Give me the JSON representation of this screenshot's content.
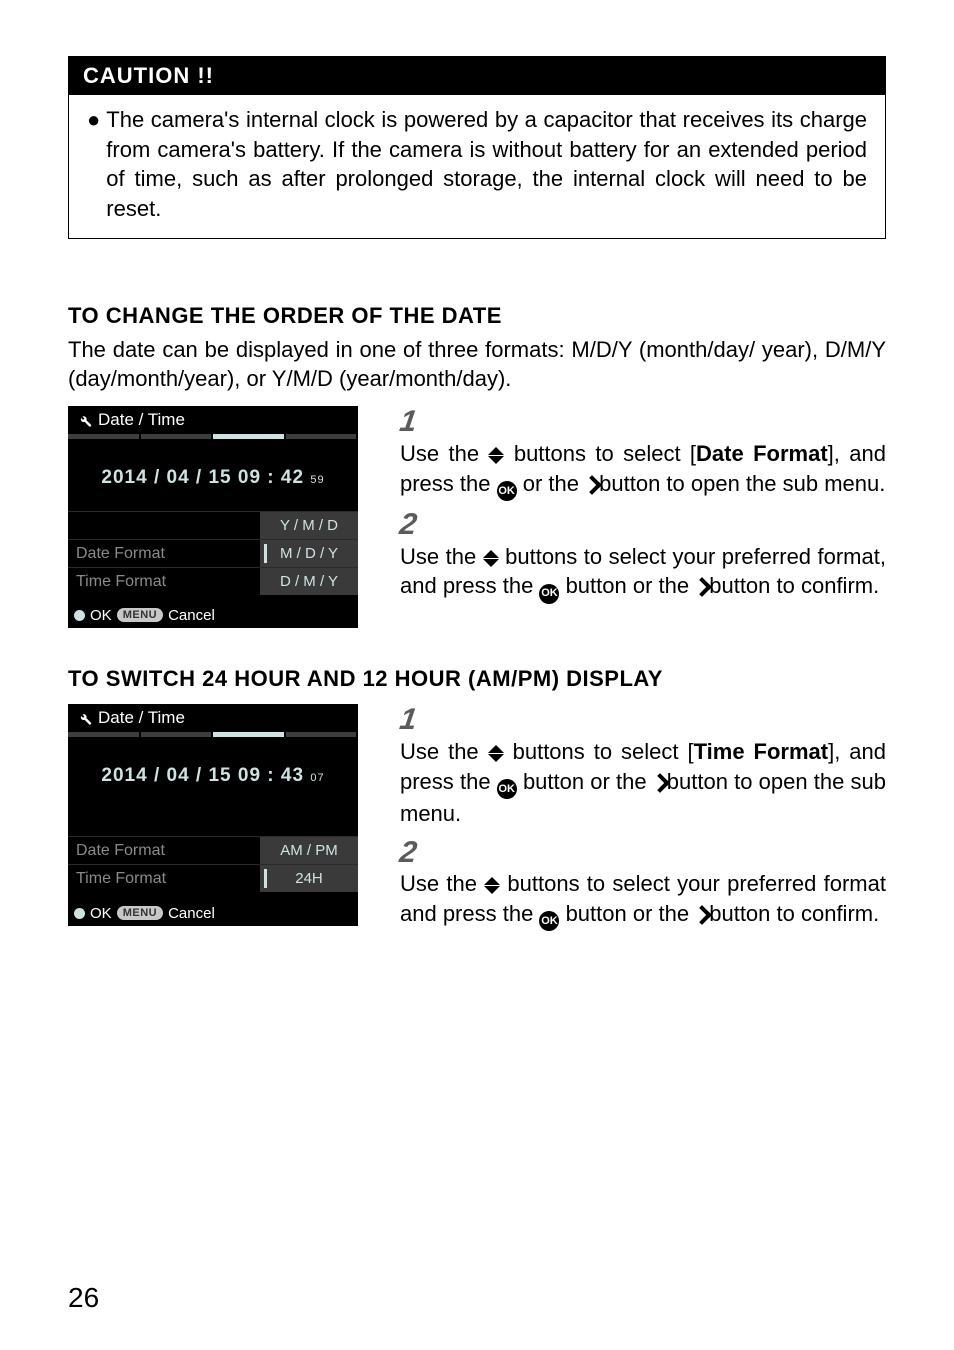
{
  "caution": {
    "header": "CAUTION !!",
    "text": "The camera's internal clock is powered by a capacitor that receives its charge from camera's battery. If the camera is without battery for an extended period of time, such as after prolonged storage, the internal clock will need to be reset."
  },
  "section1": {
    "title": "TO CHANGE THE ORDER OF THE DATE",
    "intro": "The date can be displayed in one of three formats: M/D/Y (month/day/ year), D/M/Y (day/month/year), or Y/M/D (year/month/day).",
    "step1": {
      "num": "1",
      "pre": "Use the",
      "mid": "buttons to select [",
      "bold": "Date Format",
      "post1": "], and press the",
      "post2": "or the",
      "post3": "button to open the sub menu."
    },
    "step2": {
      "num": "2",
      "pre": "Use the",
      "mid": "buttons to select your preferred format, and press the",
      "post1": "button or the",
      "post2": "button to confirm."
    },
    "screen": {
      "title": "Date / Time",
      "datetime": "2014 / 04 / 15   09 : 42",
      "sec": "59",
      "opt1": "Y / M / D",
      "opt2": "M / D / Y",
      "opt3": "D / M / Y",
      "row1label": "Date Format",
      "row2label": "Time Format",
      "ok": "OK",
      "menu": "MENU",
      "cancel": "Cancel"
    }
  },
  "section2": {
    "title": "TO SWITCH 24 HOUR AND 12 HOUR (AM/PM) DISPLAY",
    "step1": {
      "num": "1",
      "pre": "Use the",
      "mid": "buttons to select [",
      "bold": "Time Format",
      "post1": "], and press the",
      "post2": "button or the",
      "post3": "button to open the sub menu."
    },
    "step2": {
      "num": "2",
      "pre": "Use the",
      "mid": "buttons to select your preferred format and press the",
      "post1": "button or the",
      "post2": "button to confirm."
    },
    "screen": {
      "title": "Date / Time",
      "datetime": "2014 / 04 / 15   09 : 43",
      "sec": "07",
      "row1label": "Date Format",
      "row2label": "Time Format",
      "opt1": "AM / PM",
      "opt2": "24H",
      "ok": "OK",
      "menu": "MENU",
      "cancel": "Cancel"
    }
  },
  "pageNumber": "26",
  "okLabel": "OK"
}
